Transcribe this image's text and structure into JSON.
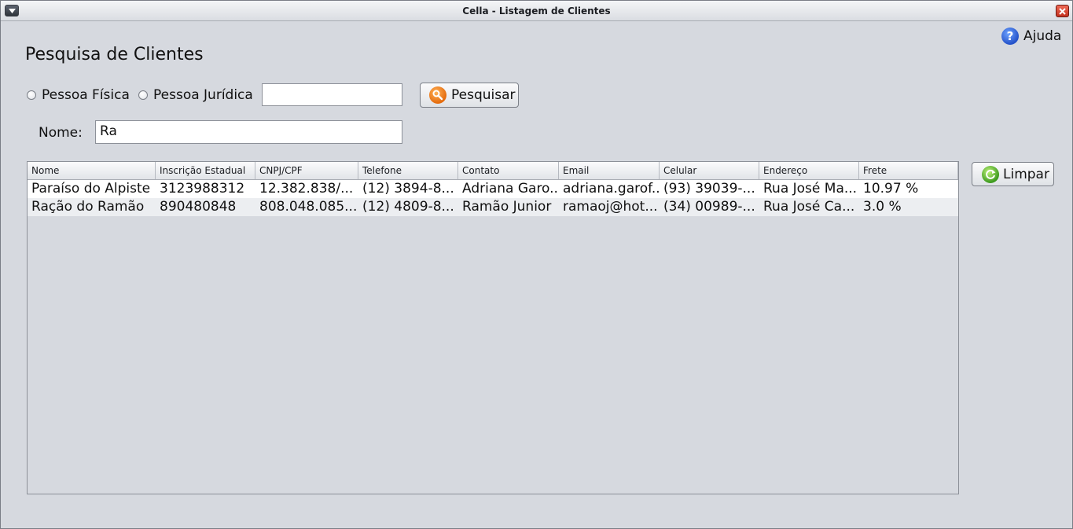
{
  "window": {
    "title": "Cella - Listagem de Clientes"
  },
  "help": {
    "label": "Ajuda"
  },
  "page": {
    "title": "Pesquisa de Clientes"
  },
  "filters": {
    "person_type_physical": "Pessoa Física",
    "person_type_legal": "Pessoa Jurídica",
    "document_value": "",
    "search_button": "Pesquisar",
    "name_label": "Nome:",
    "name_value": "Ra"
  },
  "actions": {
    "clear_button": "Limpar"
  },
  "table": {
    "columns": [
      "Nome",
      "Inscrição Estadual",
      "CNPJ/CPF",
      "Telefone",
      "Contato",
      "Email",
      "Celular",
      "Endereço",
      "Frete"
    ],
    "rows": [
      [
        "Paraíso do Alpiste",
        "3123988312",
        "12.382.838/...",
        "(12) 3894-8...",
        "Adriana Garo...",
        "adriana.garof...",
        "(93) 39039-...",
        "Rua José Ma...",
        "10.97 %"
      ],
      [
        "Ração do Ramão",
        "890480848",
        "808.048.085...",
        "(12) 4809-8...",
        "Ramão Junior",
        "ramaoj@hot...",
        "(34) 00989-...",
        "Rua José Ca...",
        "3.0 %"
      ]
    ]
  }
}
